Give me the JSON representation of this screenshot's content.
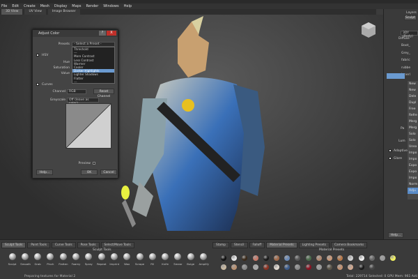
{
  "menu": [
    "File",
    "Edit",
    "Create",
    "Mesh",
    "Display",
    "Maps",
    "Render",
    "Windows",
    "Help"
  ],
  "view_tabs": [
    "3D View",
    "UV View",
    "Image Browser"
  ],
  "dialog": {
    "title": "Adjust Color",
    "help_icon": "?",
    "close_icon": "X",
    "presets_label": "Presets",
    "presets_value": "- Select a Preset -",
    "preset_options": [
      "Threshold",
      "---",
      "More Contrast",
      "Less Contrast",
      "Warmer",
      "Cooler",
      "Darker Highlights",
      "Lighter Shadows",
      "Flatter",
      "---"
    ],
    "preset_selected": "Darker Highlights",
    "hsv_label": "HSV",
    "hue_label": "Hue",
    "saturation_label": "Saturation",
    "value_label": "Value",
    "curves_label": "Curves",
    "channel_label": "Channel",
    "channel_value": "RGB",
    "reset_channel": "Reset Channel",
    "greyscale_label": "Greyscale",
    "greyscale_value": "Off (leave as color)",
    "preview_label": "Preview",
    "preview_checked": true,
    "help_button": "Help...",
    "ok_button": "OK",
    "cancel_button": "Cancel"
  },
  "layers": {
    "title": "Layers",
    "sculpt_tab": "Sculpt",
    "object": "3DY (Body)",
    "group": "Diffuse",
    "items": [
      "Boot_",
      "Grey_",
      "fabric",
      "rubbe",
      "Innerl"
    ],
    "adaptive_label": "Adaptive",
    "glare_label": "Glare",
    "help_button": "Help...",
    "partial_labels": [
      "Lum",
      "Pa"
    ]
  },
  "context_menu": [
    "New",
    "New",
    "Dele",
    "Dupl",
    "Free",
    "Refre",
    "Merg",
    "Merg",
    "Solo",
    "Solo",
    "Unso",
    "Impo",
    "Impo",
    "Expo",
    "Expo",
    "Impo",
    "Norm",
    "Adju"
  ],
  "context_selected": "Adju",
  "sculpt": {
    "tabs": [
      "Sculpt Tools",
      "Paint Tools",
      "Curve Tools",
      "Pose Tools",
      "Select/Move Tools"
    ],
    "title": "Sculpt Tools",
    "tools": [
      "Sculpt",
      "Smooth",
      "Grab",
      "Pinch",
      "Flatten",
      "Foamy",
      "Spray",
      "Repeat",
      "Imprint",
      "Wax",
      "Scrape",
      "Fill",
      "Knife",
      "Smear",
      "Bulge",
      "Amplify"
    ]
  },
  "presets": {
    "tabs": [
      "Stamp",
      "Stencil",
      "Falloff",
      "Material Presets",
      "Lighting Presets",
      "Camera Bookmarks"
    ],
    "title": "Material Presets",
    "row1": [
      "#111111",
      "#e8e8e8",
      "#3a2a1a",
      "#c87868",
      "#1a1a1a",
      "#a06848",
      "#6a8ab8",
      "#555555",
      "#4a6a4a",
      "#b08870",
      "#c89878",
      "#b87848",
      "#d0d0d0",
      "#f0f0f0",
      "#666666",
      "#999999",
      "#f0f060"
    ],
    "row2": [
      "#c8b8a0",
      "#b89070",
      "#888888",
      "#aaaaaa",
      "#8a3020",
      "#e0d8d0",
      "#3a5a8a",
      "#888888",
      "#8a1020",
      "#999999",
      "#5a5448",
      "#c09070",
      "#d0a890",
      "#1a1a1a",
      "#444444"
    ]
  },
  "status": {
    "left": "Preparing textures for Material 2",
    "right": "Total: 229714  Selected: 0  GPU Mem: 961  Acti"
  },
  "colors": {
    "accent": "#6a9ad0",
    "selection": "#5a8cc8",
    "close": "#c0302a"
  }
}
